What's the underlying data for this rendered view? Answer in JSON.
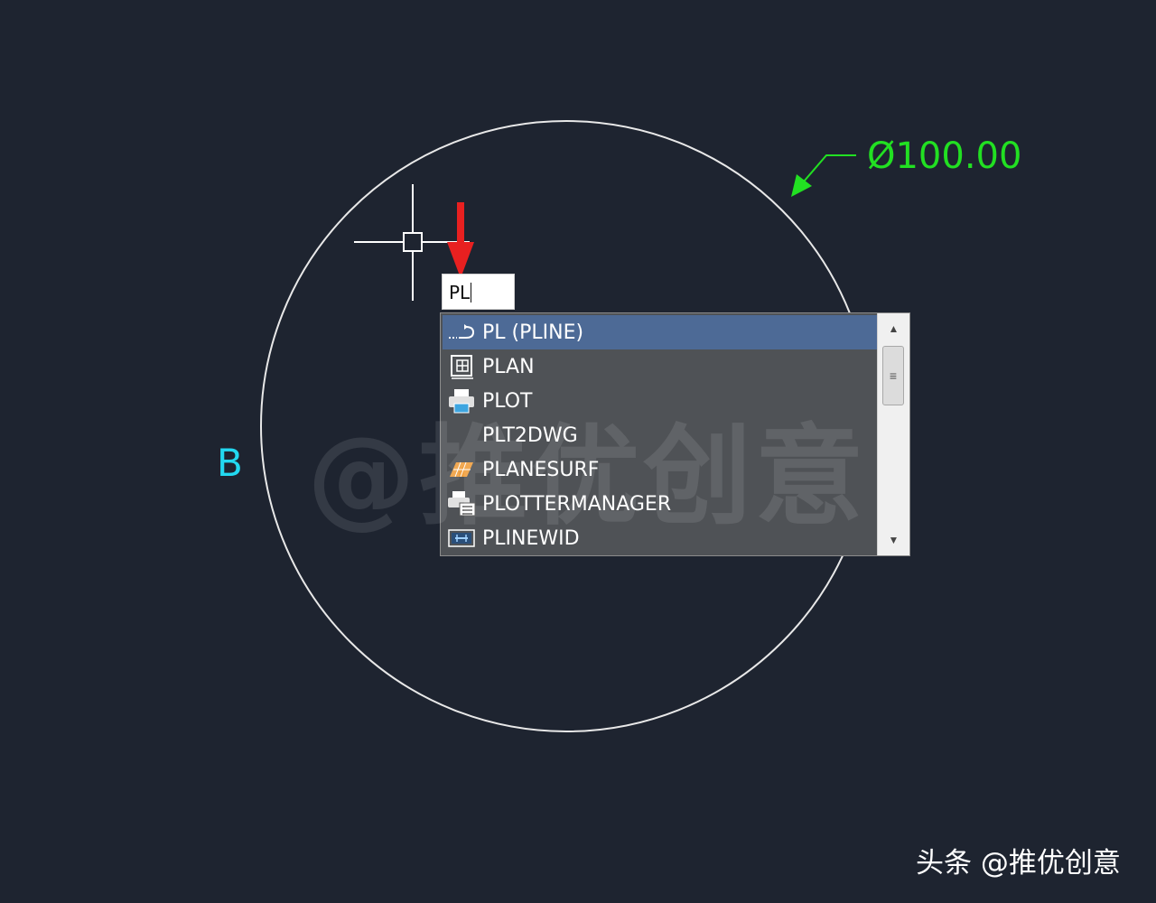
{
  "drawing": {
    "dimension_text": "Ø100.00",
    "point_label": "B",
    "colors": {
      "background": "#1e2430",
      "circle": "#e8e8e8",
      "dimension": "#22e022",
      "point_label": "#22d8f0",
      "pointer_arrow": "#e82020"
    }
  },
  "command_input": {
    "value": "PL"
  },
  "autocomplete": {
    "items": [
      {
        "label": "PL (PLINE)",
        "icon": "pline-icon",
        "selected": true
      },
      {
        "label": "PLAN",
        "icon": "plan-icon",
        "selected": false
      },
      {
        "label": "PLOT",
        "icon": "printer-icon",
        "selected": false
      },
      {
        "label": "PLT2DWG",
        "icon": "",
        "selected": false
      },
      {
        "label": "PLANESURF",
        "icon": "planesurf-icon",
        "selected": false
      },
      {
        "label": "PLOTTERMANAGER",
        "icon": "plotter-manager-icon",
        "selected": false
      },
      {
        "label": "PLINEWID",
        "icon": "plinewid-icon",
        "selected": false
      }
    ],
    "scroll_up": "▲",
    "scroll_down": "▼",
    "scroll_thumb_grip": "≡"
  },
  "watermark": "@推优创意",
  "brand": "头条 @推优创意"
}
